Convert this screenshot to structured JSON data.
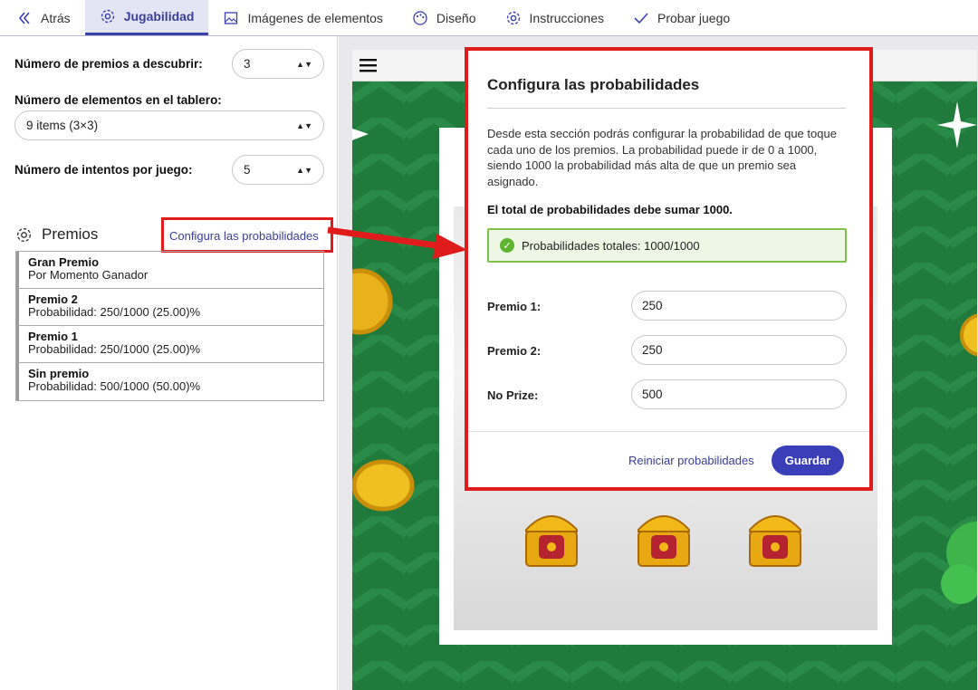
{
  "tabs": [
    {
      "label": "Atrás",
      "icon": "back-chevrons-icon"
    },
    {
      "label": "Jugabilidad",
      "icon": "gear-icon",
      "active": true
    },
    {
      "label": "Imágenes de elementos",
      "icon": "image-icon"
    },
    {
      "label": "Diseño",
      "icon": "palette-icon"
    },
    {
      "label": "Instrucciones",
      "icon": "gear-icon"
    },
    {
      "label": "Probar juego",
      "icon": "check-icon"
    }
  ],
  "settings": {
    "prizes_label": "Número de premios a descubrir:",
    "prizes_value": "3",
    "elements_label": "Número de elementos en el tablero:",
    "elements_value": "9 items (3×3)",
    "attempts_label": "Número de intentos por juego:",
    "attempts_value": "5"
  },
  "premios": {
    "heading": "Premios",
    "config_link": "Configura las probabilidades",
    "items": [
      {
        "name": "Gran Premio",
        "detail": "Por Momento Ganador"
      },
      {
        "name": "Premio 2",
        "detail": "Probabilidad: 250/1000 (25.00)%"
      },
      {
        "name": "Premio 1",
        "detail": "Probabilidad: 250/1000 (25.00)%"
      },
      {
        "name": "Sin premio",
        "detail": "Probabilidad: 500/1000 (50.00)%"
      }
    ]
  },
  "modal": {
    "title": "Configura las probabilidades",
    "description": "Desde esta sección podrás configurar la probabilidad de que toque cada uno de los premios. La probabilidad puede ir de 0 a 1000, siendo 1000 la probabilidad más alta de que un premio sea asignado.",
    "note": "El total de probabilidades debe sumar 1000.",
    "status": "Probabilidades totales: 1000/1000",
    "fields": [
      {
        "label": "Premio 1:",
        "value": "250"
      },
      {
        "label": "Premio 2:",
        "value": "250"
      },
      {
        "label": "No Prize:",
        "value": "500"
      }
    ],
    "reset_label": "Reiniciar probabilidades",
    "save_label": "Guardar"
  },
  "colors": {
    "accent": "#3a3fb8",
    "highlight": "#e01b1b",
    "success": "#5fb52f",
    "board_green": "#1f7a3b"
  }
}
